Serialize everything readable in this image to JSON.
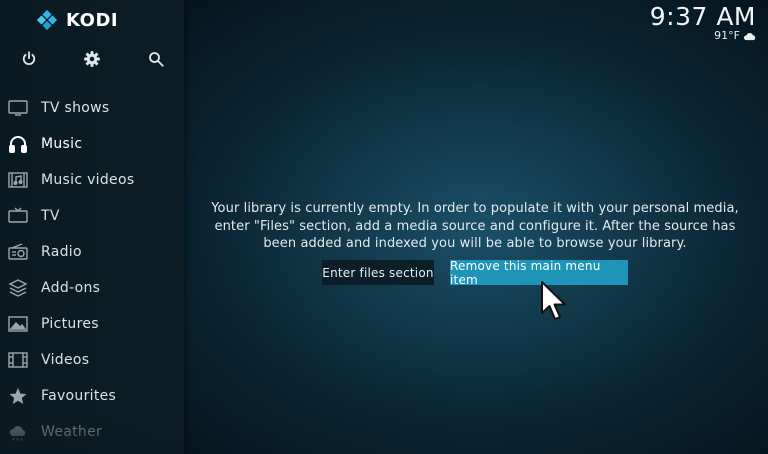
{
  "app": {
    "brand": "KODI"
  },
  "clock": {
    "time": "9:37 AM",
    "temperature": "91°F",
    "weather_icon": "cloud-icon"
  },
  "top_icons": [
    {
      "name": "power-icon"
    },
    {
      "name": "settings-icon"
    },
    {
      "name": "search-icon"
    }
  ],
  "sidebar": {
    "items": [
      {
        "label": "TV shows",
        "icon": "tv-icon"
      },
      {
        "label": "Music",
        "icon": "headphones-icon"
      },
      {
        "label": "Music videos",
        "icon": "music-video-icon"
      },
      {
        "label": "TV",
        "icon": "live-tv-icon"
      },
      {
        "label": "Radio",
        "icon": "radio-icon"
      },
      {
        "label": "Add-ons",
        "icon": "addons-icon"
      },
      {
        "label": "Pictures",
        "icon": "pictures-icon"
      },
      {
        "label": "Videos",
        "icon": "film-icon"
      },
      {
        "label": "Favourites",
        "icon": "star-icon"
      },
      {
        "label": "Weather",
        "icon": "weather-icon"
      }
    ]
  },
  "main": {
    "message": "Your library is currently empty. In order to populate it with your personal media, enter \"Files\" section, add a media source and configure it. After the source has been added and indexed you will be able to browse your library.",
    "enter_files_label": "Enter files section",
    "remove_item_label": "Remove this main menu item"
  },
  "colors": {
    "accent": "#1d94b8",
    "sidebar_bg": "#0b1d26",
    "background": "#12384a"
  }
}
